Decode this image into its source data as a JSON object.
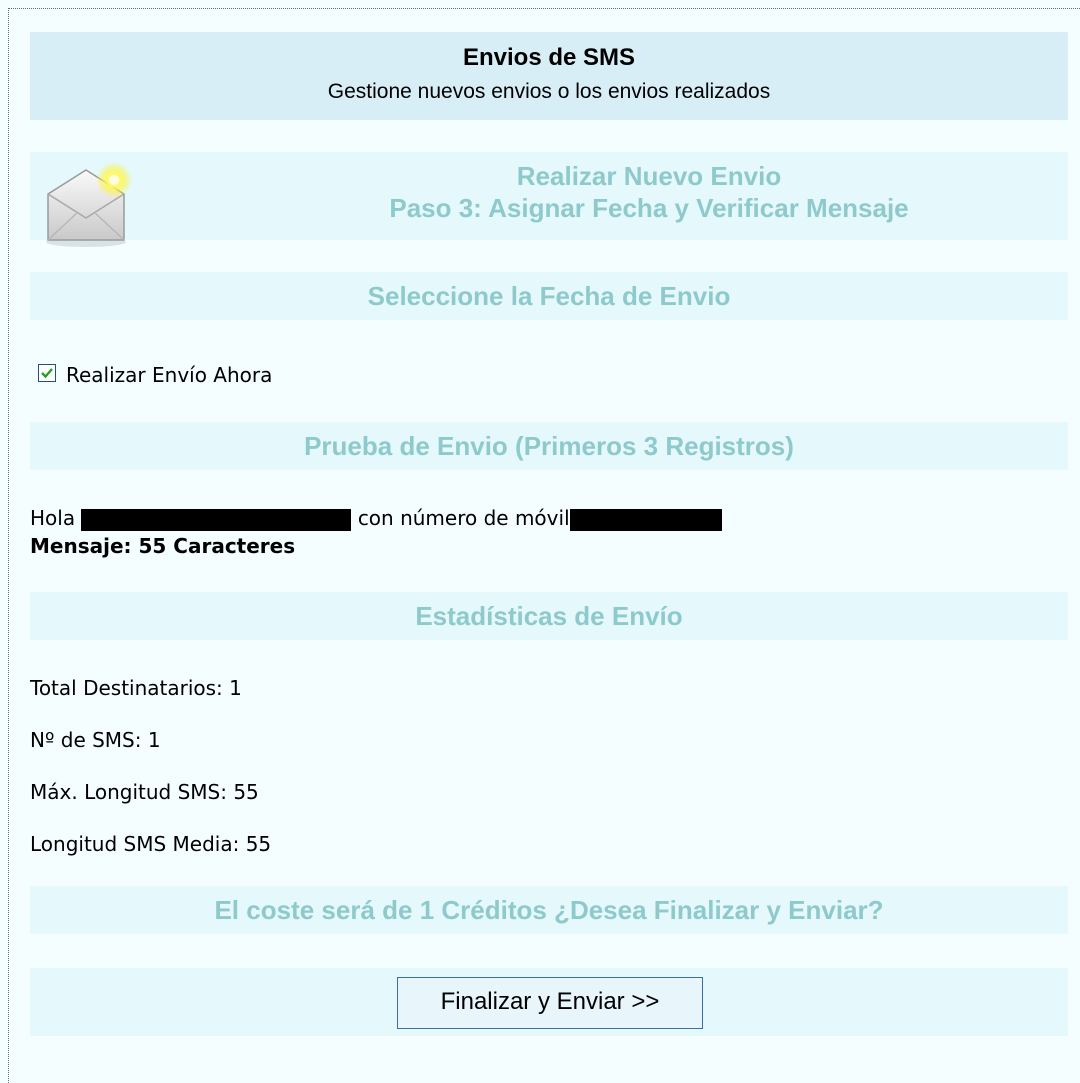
{
  "header": {
    "title": "Envios de SMS",
    "subtitle": "Gestione nuevos envios o los envios realizados"
  },
  "step": {
    "line1": "Realizar Nuevo Envio",
    "line2": "Paso 3: Asignar Fecha y Verificar Mensaje",
    "icon": "envelope-icon"
  },
  "date_section": {
    "title": "Seleccione la Fecha de Envio",
    "send_now_label": "Realizar Envío Ahora",
    "send_now_checked": true
  },
  "preview_section": {
    "title": "Prueba de Envio (Primeros 3 Registros)",
    "message_prefix": "Hola",
    "message_middle": "con número de móvil",
    "message_length": "Mensaje: 55 Caracteres"
  },
  "stats_section": {
    "title": "Estadísticas de Envío",
    "items": [
      "Total Destinatarios: 1",
      "Nº de SMS: 1",
      "Máx. Longitud SMS: 55",
      "Longitud SMS Media: 55"
    ]
  },
  "cost": {
    "text": "El coste será de 1 Créditos ¿Desea Finalizar y Enviar?"
  },
  "actions": {
    "submit_label": "Finalizar y Enviar >>"
  },
  "colors": {
    "header_bg": "#d8eef6",
    "band_bg": "#e5f8fc",
    "section_text": "#8ec9cc",
    "page_bg": "#f4fdff"
  }
}
